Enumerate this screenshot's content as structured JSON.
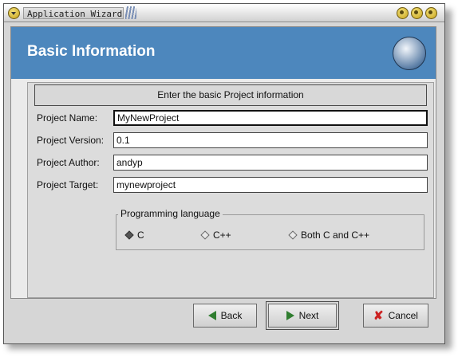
{
  "window": {
    "title": "Application Wizard"
  },
  "header": {
    "title": "Basic Information",
    "logo_icon": "kdevelop-logo-icon"
  },
  "banner": {
    "text": "Enter the basic Project information"
  },
  "form": {
    "project_name": {
      "label": "Project Name:",
      "value": "MyNewProject"
    },
    "project_version": {
      "label": "Project Version:",
      "value": "0.1"
    },
    "project_author": {
      "label": "Project Author:",
      "value": "andyp"
    },
    "project_target": {
      "label": "Project Target:",
      "value": "mynewproject"
    }
  },
  "language": {
    "title": "Programming language",
    "options": [
      {
        "label": "C",
        "selected": true
      },
      {
        "label": "C++",
        "selected": false
      },
      {
        "label": "Both C and C++",
        "selected": false
      }
    ]
  },
  "buttons": {
    "back": "Back",
    "next": "Next",
    "cancel": "Cancel"
  },
  "colors": {
    "header_bg": "#4d87bd",
    "window_bg": "#d6d6d6",
    "icon_green": "#2f7d2f",
    "icon_red": "#cc2222"
  }
}
